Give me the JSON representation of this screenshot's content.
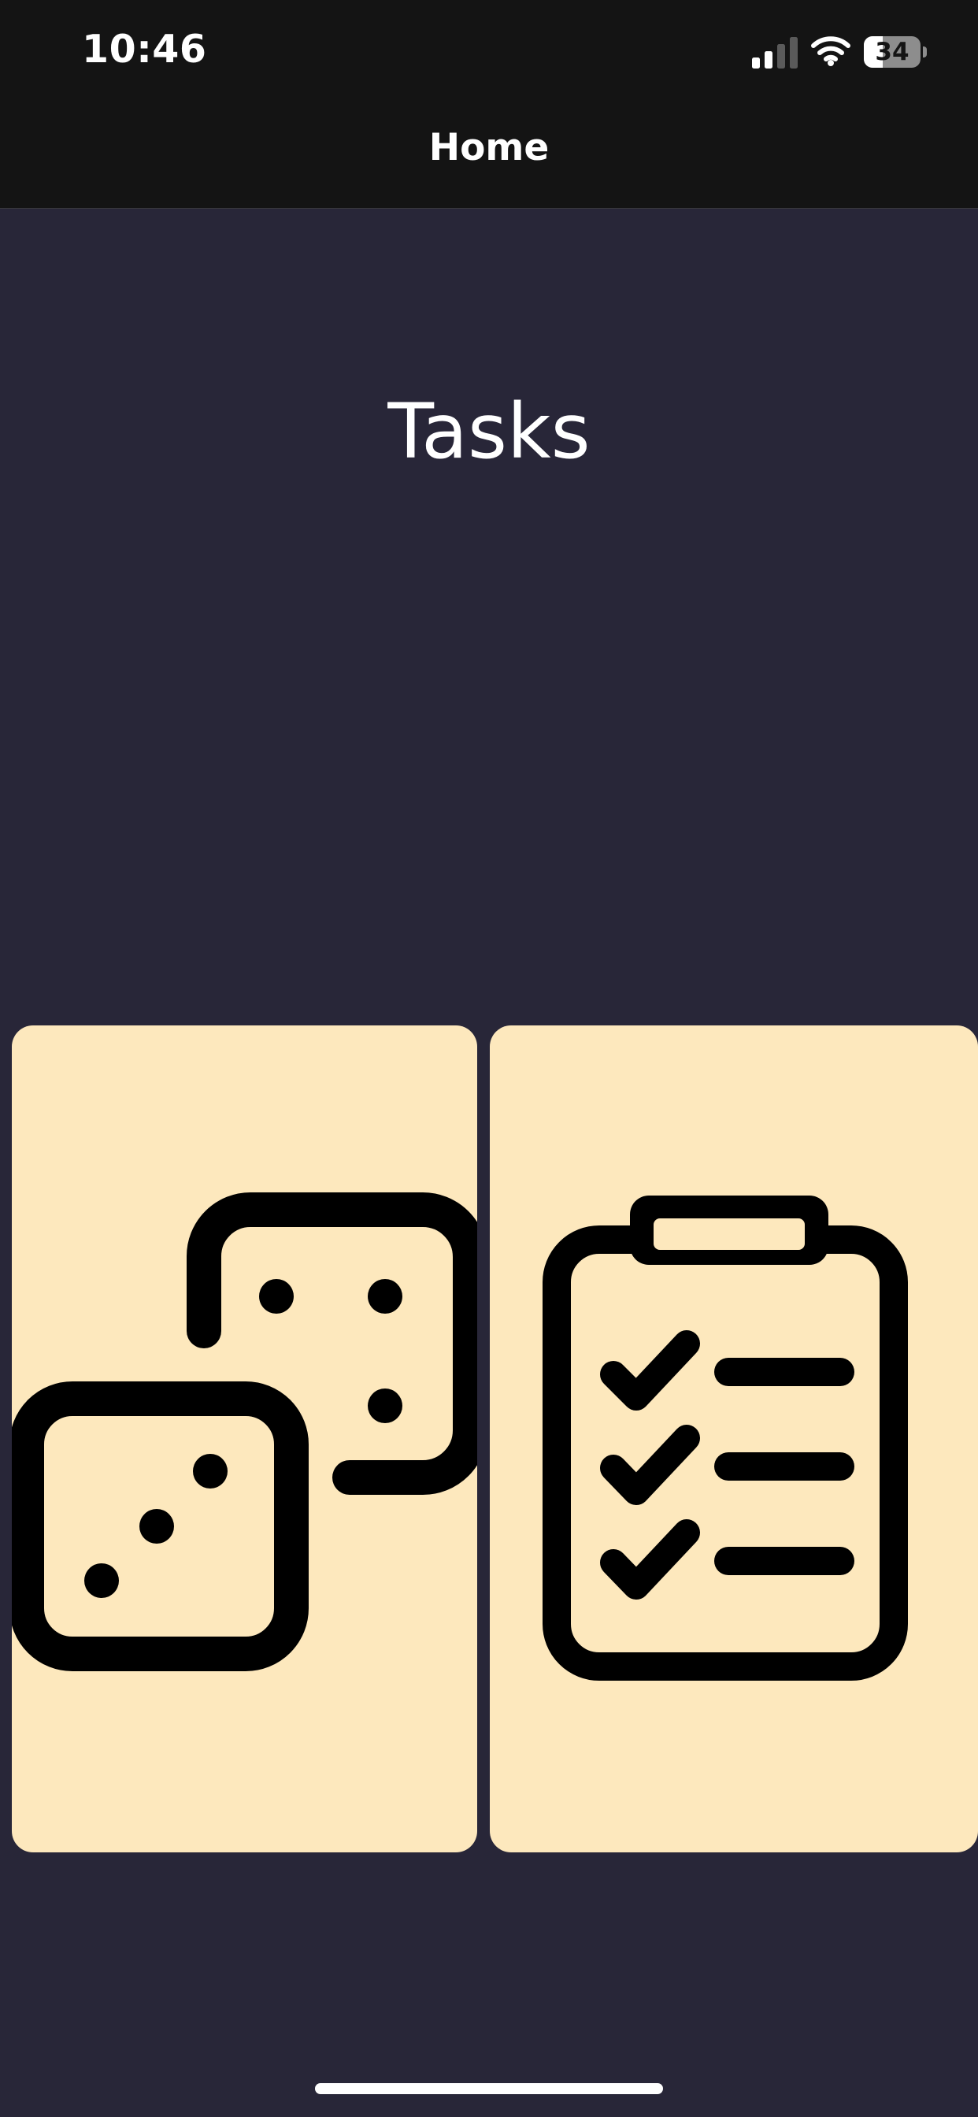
{
  "status_bar": {
    "time": "10:46",
    "signal_icon": "cellular-signal-icon",
    "signal_bars_active": 2,
    "signal_bars_total": 4,
    "wifi_icon": "wifi-icon",
    "battery_percent": "34",
    "battery_level": 0.34
  },
  "nav": {
    "title": "Home"
  },
  "main": {
    "heading": "Tasks",
    "cards": [
      {
        "icon": "dice-icon"
      },
      {
        "icon": "clipboard-checklist-icon"
      }
    ]
  },
  "colors": {
    "bars_background": "#141414",
    "page_background": "#282638",
    "card_background": "#fde8bd",
    "icon_color": "#000000",
    "text_color": "#ffffff"
  }
}
